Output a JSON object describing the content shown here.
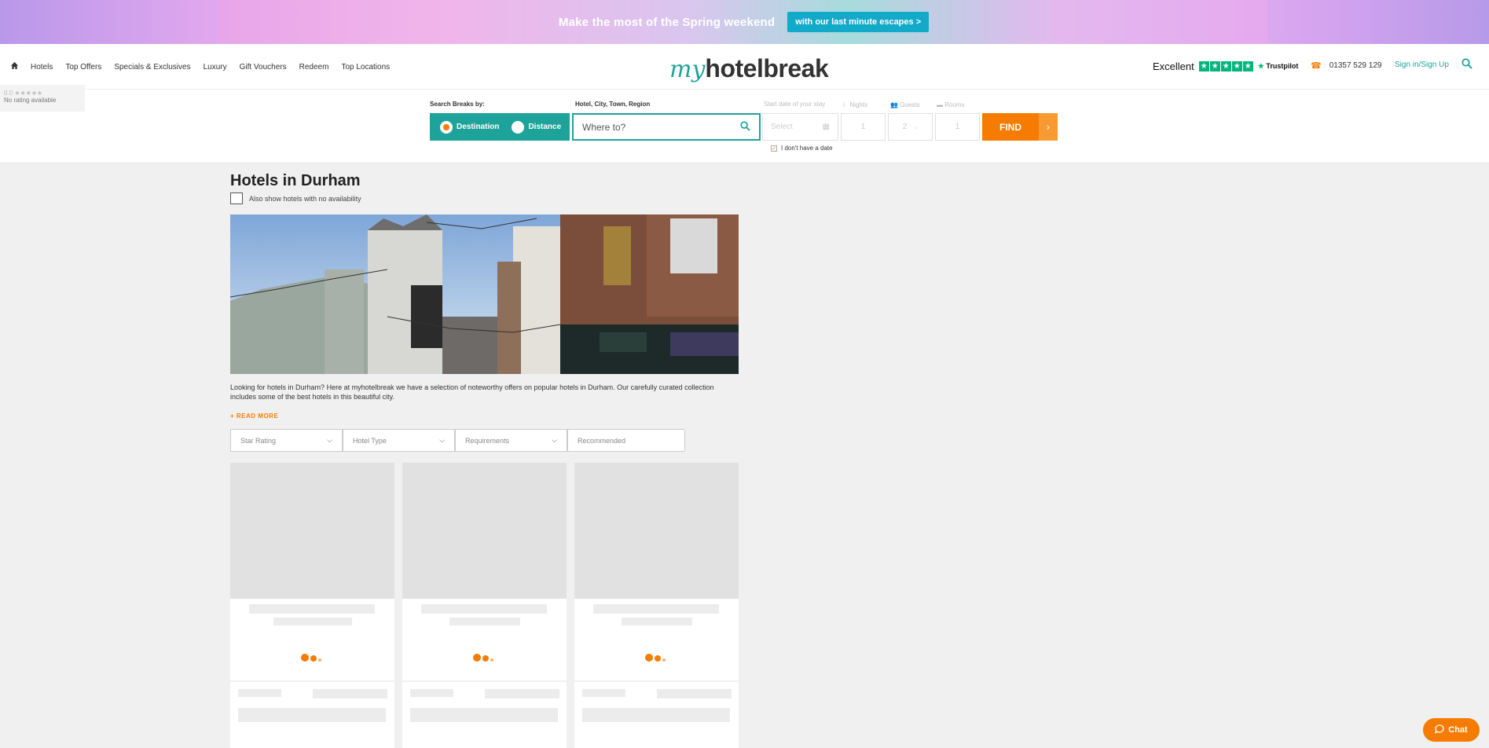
{
  "banner": {
    "text": "Make the most of the Spring weekend",
    "button": "with our last minute escapes >"
  },
  "nav": {
    "home_icon": "home-icon",
    "items": [
      "Hotels",
      "Top Offers",
      "Specials & Exclusives",
      "Luxury",
      "Gift Vouchers",
      "Redeem",
      "Top Locations"
    ]
  },
  "logo": {
    "my": "my",
    "rest": "hotelbreak"
  },
  "trustpilot": {
    "label": "Excellent",
    "brand": "Trustpilot"
  },
  "contact": {
    "phone": "01357 529 129",
    "signin": "Sign in/Sign Up"
  },
  "rating_widget": {
    "score": "0.0 ★★★★★",
    "text": "No rating available"
  },
  "search": {
    "by_label": "Search Breaks by:",
    "mode_destination": "Destination",
    "mode_distance": "Distance",
    "where_label": "Hotel, City, Town, Region",
    "where_placeholder": "Where to?",
    "date_label": "Start date of your stay",
    "date_placeholder": "Select",
    "nights_label": "Nights",
    "nights_value": "1",
    "guests_label": "Guests",
    "guests_value": "2",
    "rooms_label": "Rooms",
    "rooms_value": "1",
    "find": "FIND",
    "no_date": "I don't have a date"
  },
  "main": {
    "title": "Hotels in Durham",
    "availability": "Also show hotels with no availability",
    "description": "Looking for hotels in Durham? Here at myhotelbreak we have a selection of noteworthy offers on popular hotels in Durham. Our carefully curated collection includes some of the best hotels in this beautiful city.",
    "read_more": "+ READ MORE",
    "filters": [
      "Star Rating",
      "Hotel Type",
      "Requirements",
      "Recommended"
    ]
  },
  "chat": {
    "label": "Chat"
  },
  "colors": {
    "brand": "#1ea39a",
    "accent": "#f57c00",
    "banner_button": "#13a9c8",
    "trustpilot": "#00b67a"
  }
}
